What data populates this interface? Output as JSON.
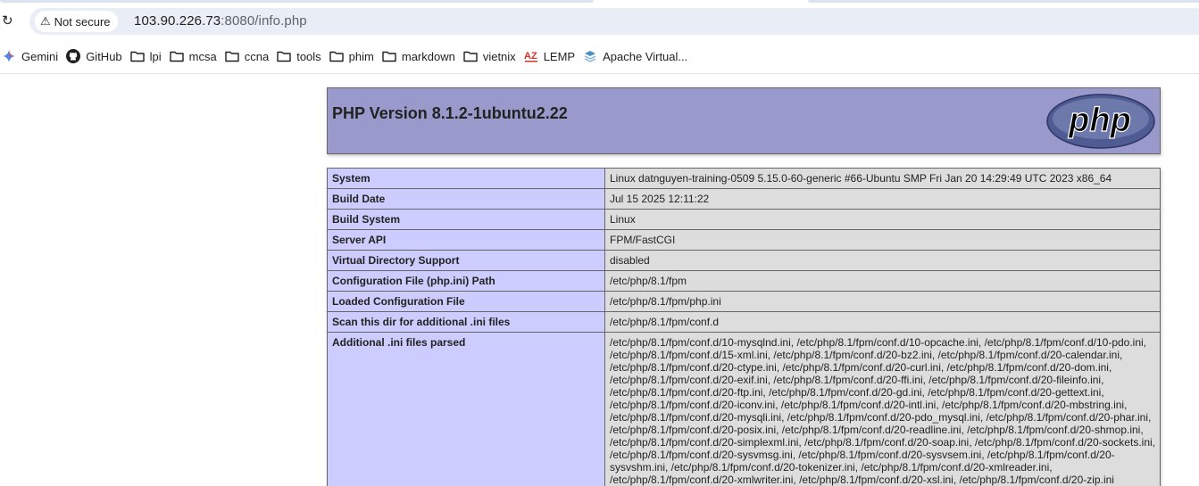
{
  "browser": {
    "security_chip": "Not secure",
    "url_host": "103.90.226.73",
    "url_rest": ":8080/info.php"
  },
  "bookmarks": [
    {
      "label": "Gemini",
      "icon": "gemini-icon"
    },
    {
      "label": "GitHub",
      "icon": "github-icon"
    },
    {
      "label": "lpi",
      "icon": "folder-icon"
    },
    {
      "label": "mcsa",
      "icon": "folder-icon"
    },
    {
      "label": "ccna",
      "icon": "folder-icon"
    },
    {
      "label": "tools",
      "icon": "folder-icon"
    },
    {
      "label": "phim",
      "icon": "folder-icon"
    },
    {
      "label": "markdown",
      "icon": "folder-icon"
    },
    {
      "label": "vietnix",
      "icon": "folder-icon"
    },
    {
      "label": "LEMP",
      "icon": "az-logo-icon"
    },
    {
      "label": "Apache Virtual...",
      "icon": "layers-icon"
    }
  ],
  "phpinfo": {
    "title": "PHP Version 8.1.2-1ubuntu2.22",
    "logo_text": "php",
    "rows": [
      {
        "key": "System",
        "value": "Linux datnguyen-training-0509 5.15.0-60-generic #66-Ubuntu SMP Fri Jan 20 14:29:49 UTC 2023 x86_64"
      },
      {
        "key": "Build Date",
        "value": "Jul 15 2025 12:11:22"
      },
      {
        "key": "Build System",
        "value": "Linux"
      },
      {
        "key": "Server API",
        "value": "FPM/FastCGI"
      },
      {
        "key": "Virtual Directory Support",
        "value": "disabled"
      },
      {
        "key": "Configuration File (php.ini) Path",
        "value": "/etc/php/8.1/fpm"
      },
      {
        "key": "Loaded Configuration File",
        "value": "/etc/php/8.1/fpm/php.ini"
      },
      {
        "key": "Scan this dir for additional .ini files",
        "value": "/etc/php/8.1/fpm/conf.d"
      }
    ],
    "ini_row": {
      "key": "Additional .ini files parsed",
      "lines": [
        "/etc/php/8.1/fpm/conf.d/10-mysqlnd.ini, /etc/php/8.1/fpm/conf.d/10-opcache.ini, /etc/php/8.1/fpm/conf.d/10-pdo.ini,",
        "/etc/php/8.1/fpm/conf.d/15-xml.ini, /etc/php/8.1/fpm/conf.d/20-bz2.ini, /etc/php/8.1/fpm/conf.d/20-calendar.ini,",
        "/etc/php/8.1/fpm/conf.d/20-ctype.ini, /etc/php/8.1/fpm/conf.d/20-curl.ini, /etc/php/8.1/fpm/conf.d/20-dom.ini,",
        "/etc/php/8.1/fpm/conf.d/20-exif.ini, /etc/php/8.1/fpm/conf.d/20-ffi.ini, /etc/php/8.1/fpm/conf.d/20-fileinfo.ini,",
        "/etc/php/8.1/fpm/conf.d/20-ftp.ini, /etc/php/8.1/fpm/conf.d/20-gd.ini, /etc/php/8.1/fpm/conf.d/20-gettext.ini,",
        "/etc/php/8.1/fpm/conf.d/20-iconv.ini, /etc/php/8.1/fpm/conf.d/20-intl.ini, /etc/php/8.1/fpm/conf.d/20-mbstring.ini,",
        "/etc/php/8.1/fpm/conf.d/20-mysqli.ini, /etc/php/8.1/fpm/conf.d/20-pdo_mysql.ini, /etc/php/8.1/fpm/conf.d/20-phar.ini,",
        "/etc/php/8.1/fpm/conf.d/20-posix.ini, /etc/php/8.1/fpm/conf.d/20-readline.ini, /etc/php/8.1/fpm/conf.d/20-shmop.ini,",
        "/etc/php/8.1/fpm/conf.d/20-simplexml.ini, /etc/php/8.1/fpm/conf.d/20-soap.ini, /etc/php/8.1/fpm/conf.d/20-sockets.ini,",
        "/etc/php/8.1/fpm/conf.d/20-sysvmsg.ini, /etc/php/8.1/fpm/conf.d/20-sysvsem.ini, /etc/php/8.1/fpm/conf.d/20-",
        "sysvshm.ini, /etc/php/8.1/fpm/conf.d/20-tokenizer.ini, /etc/php/8.1/fpm/conf.d/20-xmlreader.ini,",
        "/etc/php/8.1/fpm/conf.d/20-xmlwriter.ini, /etc/php/8.1/fpm/conf.d/20-xsl.ini, /etc/php/8.1/fpm/conf.d/20-zip.ini"
      ]
    }
  },
  "colors": {
    "header_bg": "#9999cc",
    "key_bg": "#ccccff",
    "value_bg": "#dddddd",
    "omnibox_bg": "#e9eef6"
  }
}
